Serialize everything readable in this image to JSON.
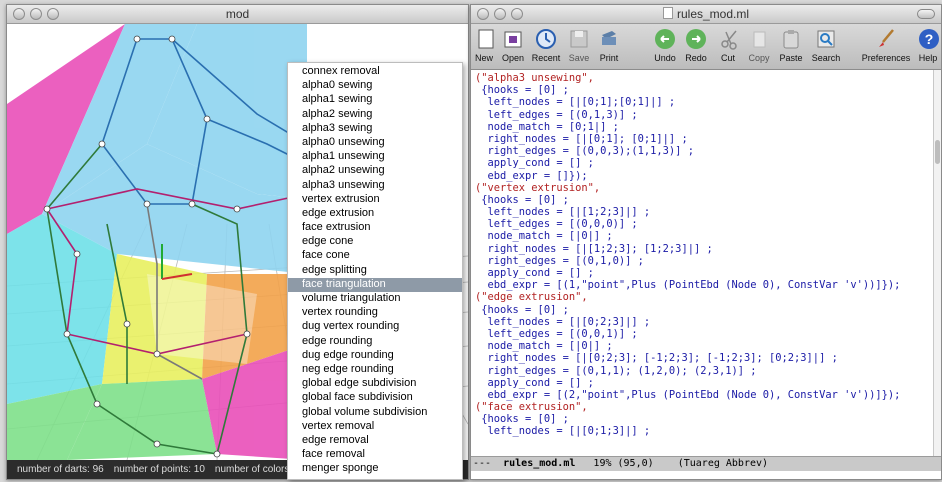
{
  "left_window": {
    "title": "mod",
    "status": {
      "darts": "number of darts: 96",
      "points": "number of points: 10",
      "colors": "number of colors:"
    }
  },
  "popup_menu": {
    "items": [
      "connex removal",
      "alpha0 sewing",
      "alpha1 sewing",
      "alpha2 sewing",
      "alpha3 sewing",
      "alpha0 unsewing",
      "alpha1 unsewing",
      "alpha2 unsewing",
      "alpha3 unsewing",
      "vertex extrusion",
      "edge extrusion",
      "face extrusion",
      "edge cone",
      "face cone",
      "edge splitting",
      "face triangulation",
      "volume triangulation",
      "vertex rounding",
      "dug vertex rounding",
      "edge rounding",
      "dug edge rounding",
      "neg edge rounding",
      "global edge subdivision",
      "global face subdivision",
      "global volume subdivision",
      "vertex removal",
      "edge removal",
      "face removal",
      "menger sponge"
    ],
    "selected": "face triangulation"
  },
  "right_window": {
    "title": "rules_mod.ml",
    "toolbar": [
      {
        "label": "New",
        "icon": "new-file-icon"
      },
      {
        "label": "Open",
        "icon": "open-icon"
      },
      {
        "label": "Recent",
        "icon": "clock-icon"
      },
      {
        "label": "Save",
        "icon": "save-icon"
      },
      {
        "label": "Print",
        "icon": "print-icon"
      },
      {
        "label": "Undo",
        "icon": "undo-icon"
      },
      {
        "label": "Redo",
        "icon": "redo-icon"
      },
      {
        "label": "Cut",
        "icon": "scissors-icon"
      },
      {
        "label": "Copy",
        "icon": "copy-icon"
      },
      {
        "label": "Paste",
        "icon": "paste-icon"
      },
      {
        "label": "Search",
        "icon": "search-icon"
      },
      {
        "label": "Preferences",
        "icon": "brush-icon"
      },
      {
        "label": "Help",
        "icon": "help-icon"
      }
    ],
    "code_lines": [
      "(\"alpha3 unsewing\",",
      " {hooks = [0] ;",
      "  left_nodes = [|[0;1];[0;1]|] ;",
      "  left_edges = [(0,1,3)] ;",
      "  node_match = [0;1|] ;",
      "  right_nodes = [|[0;1]; [0;1]|] ;",
      "  right_edges = [(0,0,3);(1,1,3)] ;",
      "  apply_cond = [] ;",
      "  ebd_expr = []});",
      "(\"vertex extrusion\",",
      " {hooks = [0] ;",
      "  left_nodes = [|[1;2;3]|] ;",
      "  left_edges = [(0,0,0)] ;",
      "  node_match = [|0|] ;",
      "  right_nodes = [|[1;2;3]; [1;2;3]|] ;",
      "  right_edges = [(0,1,0)] ;",
      "  apply_cond = [] ;",
      "  ebd_expr = [(1,\"point\",Plus (PointEbd (Node 0), ConstVar 'v'))]});",
      "(\"edge extrusion\",",
      " {hooks = [0] ;",
      "  left_nodes = [|[0;2;3]|] ;",
      "  left_edges = [(0,0,1)] ;",
      "  node_match = [|0|] ;",
      "  right_nodes = [|[0;2;3]; [-1;2;3]; [-1;2;3]; [0;2;3]|] ;",
      "  right_edges = [(0,1,1); (1,2,0); (2,3,1)] ;",
      "  apply_cond = [] ;",
      "  ebd_expr = [(2,\"point\",Plus (PointEbd (Node 0), ConstVar 'v'))]});",
      "(\"face extrusion\",",
      " {hooks = [0] ;",
      "  left_nodes = [|[0;1;3]|] ;"
    ],
    "modeline": {
      "prefix": "---  ",
      "filename": "rules_mod.ml",
      "position": "   19% (95,0)    ",
      "mode": "(Tuareg Abbrev)"
    }
  },
  "colors": {
    "menu_selection": "#8e9aa7",
    "status_bar": "#2c2c2c",
    "cyan_face": "#8fd4f0",
    "magenta_face": "#e94fb9",
    "green_face": "#7fe08a",
    "yellow_face": "#e8f060"
  }
}
